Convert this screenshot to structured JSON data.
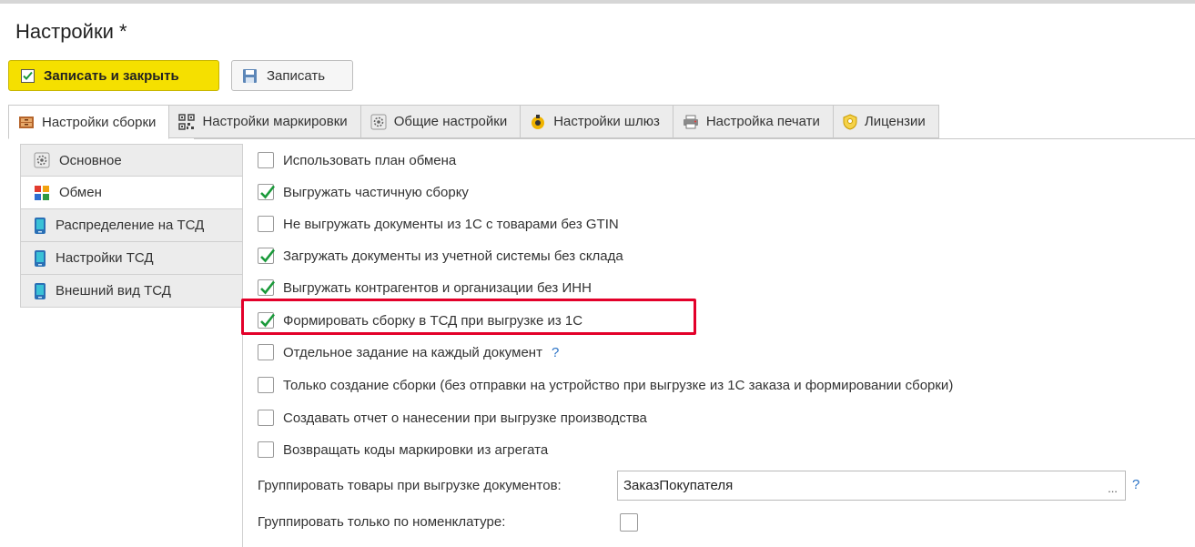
{
  "window": {
    "title": "Настройки *"
  },
  "toolbar": {
    "save_close_label": "Записать и закрыть",
    "save_label": "Записать"
  },
  "tabs": [
    {
      "label": "Настройки сборки",
      "icon": "cabinet-icon",
      "active": true
    },
    {
      "label": "Настройки маркировки",
      "icon": "qr-code-icon",
      "active": false
    },
    {
      "label": "Общие настройки",
      "icon": "gear-icon",
      "active": false
    },
    {
      "label": "Настройки шлюз",
      "icon": "gateway-icon",
      "active": false
    },
    {
      "label": "Настройка печати",
      "icon": "printer-icon",
      "active": false
    },
    {
      "label": "Лицензии",
      "icon": "license-icon",
      "active": false
    }
  ],
  "sidebar": {
    "items": [
      {
        "label": "Основное",
        "icon": "gear-icon",
        "active": false
      },
      {
        "label": "Обмен",
        "icon": "exchange-icon",
        "active": true
      },
      {
        "label": "Распределение на ТСД",
        "icon": "device-icon",
        "active": false
      },
      {
        "label": "Настройки ТСД",
        "icon": "device-icon",
        "active": false
      },
      {
        "label": "Внешний вид ТСД",
        "icon": "device-icon",
        "active": false
      }
    ]
  },
  "options": [
    {
      "label": "Использовать план обмена",
      "checked": false
    },
    {
      "label": "Выгружать частичную сборку",
      "checked": true
    },
    {
      "label": "Не выгружать документы из 1С с товарами без GTIN",
      "checked": false
    },
    {
      "label": "Загружать документы из учетной системы без склада",
      "checked": true
    },
    {
      "label": "Выгружать контрагентов и организации без ИНН",
      "checked": true
    },
    {
      "label": "Формировать сборку в ТСД при выгрузке из 1С",
      "checked": true
    },
    {
      "label": "Отдельное задание на каждый документ",
      "checked": false,
      "help": "?"
    },
    {
      "label": "Только создание сборки (без отправки на устройство при выгрузке из 1С заказа и формировании сборки)",
      "checked": false
    },
    {
      "label": "Создавать отчет о нанесении при выгрузке производства",
      "checked": false
    },
    {
      "label": "Возвращать коды маркировки из агрегата",
      "checked": false
    }
  ],
  "group_by": {
    "label": "Группировать товары при выгрузке документов:",
    "value": "ЗаказПокупателя",
    "button": "...",
    "help": "?"
  },
  "group_nomenclature": {
    "label": "Группировать только по номенклатуре:",
    "checked": false
  },
  "colors": {
    "primary_button": "#f5e000",
    "highlight_border": "#e3002a",
    "checkmark": "#1a9a3a",
    "help": "#2b73c6"
  }
}
